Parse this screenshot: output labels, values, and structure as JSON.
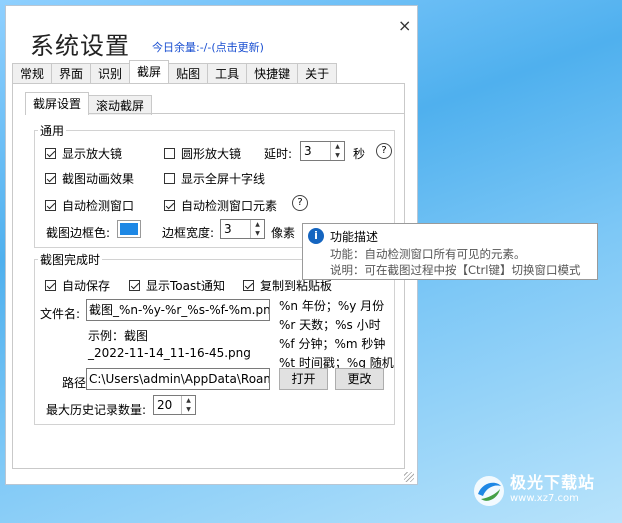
{
  "window": {
    "title": "系统设置",
    "quota_text": "今日余量:-/-(点击更新)",
    "close_glyph": "×"
  },
  "tabs": [
    "常规",
    "界面",
    "识别",
    "截屏",
    "贴图",
    "工具",
    "快捷键",
    "关于"
  ],
  "active_tab": "截屏",
  "subtabs": [
    "截屏设置",
    "滚动截屏"
  ],
  "active_subtab": "截屏设置",
  "general": {
    "label": "通用",
    "show_magnifier": "显示放大镜",
    "round_magnifier": "圆形放大镜",
    "delay_label": "延时:",
    "delay_value": "3",
    "delay_unit": "秒",
    "help1": "?",
    "animation": "截图动画效果",
    "crosshair": "显示全屏十字线",
    "auto_window": "自动检测窗口",
    "auto_element": "自动检测窗口元素",
    "help2": "?",
    "border_color_label": "截图边框色:",
    "border_color": "#1e88e5",
    "border_width_label": "边框宽度:",
    "border_width_value": "3",
    "border_width_unit": "像素"
  },
  "after": {
    "label": "截图完成时",
    "auto_save": "自动保存",
    "toast": "显示Toast通知",
    "copy_clipboard": "复制到粘贴板",
    "filename_label": "文件名:",
    "filename_value": "截图_%n-%y-%r_%s-%f-%m.png",
    "example_line1": "示例：截图",
    "example_line2": "_2022-11-14_11-16-45.png",
    "legend": [
      "%n 年份；%y 月份",
      "%r 天数；%s 小时",
      "%f 分钟；%m 秒钟",
      "%t 时间戳；%g 随机"
    ],
    "path_label": "路径:",
    "path_value": "C:\\Users\\admin\\AppData\\Roaming",
    "open_button": "打开",
    "change_button": "更改",
    "max_history_label": "最大历史记录数量:",
    "max_history_value": "20"
  },
  "tooltip": {
    "icon": "i",
    "title": "功能描述",
    "line1": "功能：自动检测窗口所有可见的元素。",
    "line2": "说明：可在截图过程中按【Ctrl键】切换窗口模式"
  },
  "watermark": {
    "name": "极光下载站",
    "url": "www.xz7.com"
  }
}
